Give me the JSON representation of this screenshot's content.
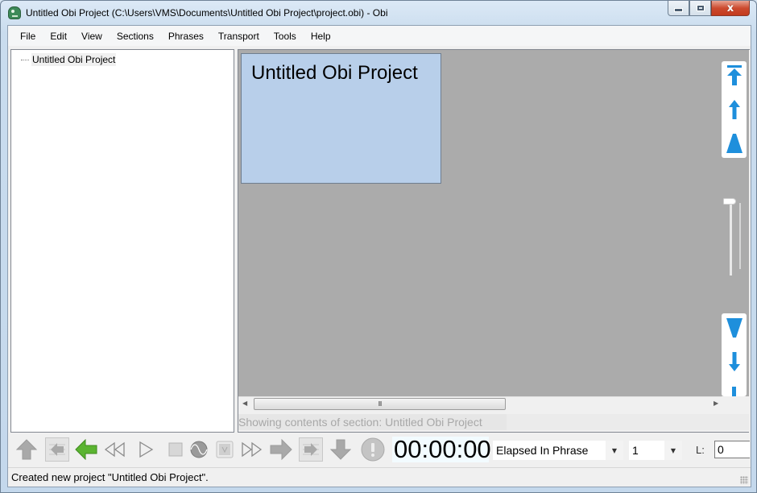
{
  "window": {
    "title": "Untitled Obi Project (C:\\Users\\VMS\\Documents\\Untitled Obi Project\\project.obi) - Obi",
    "app_icon": "obi-app-icon",
    "controls": {
      "minimize": "minimize-icon",
      "maximize": "maximize-icon",
      "close_glyph": "x"
    }
  },
  "menubar": {
    "items": [
      {
        "label": "File"
      },
      {
        "label": "Edit"
      },
      {
        "label": "View"
      },
      {
        "label": "Sections"
      },
      {
        "label": "Phrases"
      },
      {
        "label": "Transport"
      },
      {
        "label": "Tools"
      },
      {
        "label": "Help"
      }
    ]
  },
  "tree": {
    "nodes": [
      {
        "label": "Untitled Obi Project",
        "selected": true
      }
    ]
  },
  "content": {
    "section_title": "Untitled Obi Project",
    "section_color": "#b8cfea",
    "hscroll_grip": "III",
    "status_strip": "Showing contents of section:  Untitled Obi Project",
    "nav_icons": [
      "go-to-top-icon",
      "previous-icon",
      "page-up-icon",
      "zoom-slider",
      "page-down-icon",
      "next-icon",
      "go-to-bottom-icon"
    ]
  },
  "toolbar": {
    "buttons": [
      {
        "name": "previous-section-icon",
        "enabled": false
      },
      {
        "name": "previous-phrase-icon",
        "enabled": false
      },
      {
        "name": "previous-page-icon",
        "enabled": true
      },
      {
        "name": "rewind-icon",
        "enabled": true
      },
      {
        "name": "play-icon",
        "enabled": true
      },
      {
        "name": "stop-icon",
        "enabled": false
      },
      {
        "name": "record-monitor-icon",
        "enabled": false
      },
      {
        "name": "pause-icon",
        "enabled": false
      },
      {
        "name": "fast-forward-icon",
        "enabled": true
      },
      {
        "name": "next-page-icon",
        "enabled": false
      },
      {
        "name": "next-phrase-icon",
        "enabled": false
      },
      {
        "name": "next-section-icon",
        "enabled": false
      },
      {
        "name": "alert-icon",
        "enabled": false
      }
    ],
    "time": "00:00:00",
    "time_mode": "Elapsed In Phrase",
    "level_select": "1",
    "l_label": "L:",
    "l_value": "0",
    "accent_color": "#1e8fdc",
    "green_arrow_color": "#5bb431"
  },
  "statusbar": {
    "message": "Created new project \"Untitled Obi Project\"."
  }
}
